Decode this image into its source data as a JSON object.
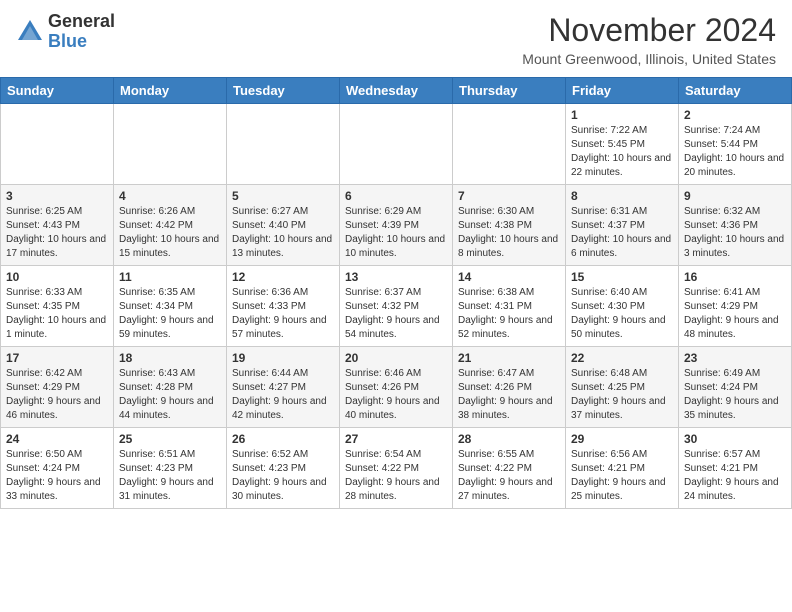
{
  "header": {
    "logo_line1": "General",
    "logo_line2": "Blue",
    "month": "November 2024",
    "location": "Mount Greenwood, Illinois, United States"
  },
  "days_of_week": [
    "Sunday",
    "Monday",
    "Tuesday",
    "Wednesday",
    "Thursday",
    "Friday",
    "Saturday"
  ],
  "weeks": [
    [
      {
        "day": "",
        "info": ""
      },
      {
        "day": "",
        "info": ""
      },
      {
        "day": "",
        "info": ""
      },
      {
        "day": "",
        "info": ""
      },
      {
        "day": "",
        "info": ""
      },
      {
        "day": "1",
        "info": "Sunrise: 7:22 AM\nSunset: 5:45 PM\nDaylight: 10 hours and 22 minutes."
      },
      {
        "day": "2",
        "info": "Sunrise: 7:24 AM\nSunset: 5:44 PM\nDaylight: 10 hours and 20 minutes."
      }
    ],
    [
      {
        "day": "3",
        "info": "Sunrise: 6:25 AM\nSunset: 4:43 PM\nDaylight: 10 hours and 17 minutes."
      },
      {
        "day": "4",
        "info": "Sunrise: 6:26 AM\nSunset: 4:42 PM\nDaylight: 10 hours and 15 minutes."
      },
      {
        "day": "5",
        "info": "Sunrise: 6:27 AM\nSunset: 4:40 PM\nDaylight: 10 hours and 13 minutes."
      },
      {
        "day": "6",
        "info": "Sunrise: 6:29 AM\nSunset: 4:39 PM\nDaylight: 10 hours and 10 minutes."
      },
      {
        "day": "7",
        "info": "Sunrise: 6:30 AM\nSunset: 4:38 PM\nDaylight: 10 hours and 8 minutes."
      },
      {
        "day": "8",
        "info": "Sunrise: 6:31 AM\nSunset: 4:37 PM\nDaylight: 10 hours and 6 minutes."
      },
      {
        "day": "9",
        "info": "Sunrise: 6:32 AM\nSunset: 4:36 PM\nDaylight: 10 hours and 3 minutes."
      }
    ],
    [
      {
        "day": "10",
        "info": "Sunrise: 6:33 AM\nSunset: 4:35 PM\nDaylight: 10 hours and 1 minute."
      },
      {
        "day": "11",
        "info": "Sunrise: 6:35 AM\nSunset: 4:34 PM\nDaylight: 9 hours and 59 minutes."
      },
      {
        "day": "12",
        "info": "Sunrise: 6:36 AM\nSunset: 4:33 PM\nDaylight: 9 hours and 57 minutes."
      },
      {
        "day": "13",
        "info": "Sunrise: 6:37 AM\nSunset: 4:32 PM\nDaylight: 9 hours and 54 minutes."
      },
      {
        "day": "14",
        "info": "Sunrise: 6:38 AM\nSunset: 4:31 PM\nDaylight: 9 hours and 52 minutes."
      },
      {
        "day": "15",
        "info": "Sunrise: 6:40 AM\nSunset: 4:30 PM\nDaylight: 9 hours and 50 minutes."
      },
      {
        "day": "16",
        "info": "Sunrise: 6:41 AM\nSunset: 4:29 PM\nDaylight: 9 hours and 48 minutes."
      }
    ],
    [
      {
        "day": "17",
        "info": "Sunrise: 6:42 AM\nSunset: 4:29 PM\nDaylight: 9 hours and 46 minutes."
      },
      {
        "day": "18",
        "info": "Sunrise: 6:43 AM\nSunset: 4:28 PM\nDaylight: 9 hours and 44 minutes."
      },
      {
        "day": "19",
        "info": "Sunrise: 6:44 AM\nSunset: 4:27 PM\nDaylight: 9 hours and 42 minutes."
      },
      {
        "day": "20",
        "info": "Sunrise: 6:46 AM\nSunset: 4:26 PM\nDaylight: 9 hours and 40 minutes."
      },
      {
        "day": "21",
        "info": "Sunrise: 6:47 AM\nSunset: 4:26 PM\nDaylight: 9 hours and 38 minutes."
      },
      {
        "day": "22",
        "info": "Sunrise: 6:48 AM\nSunset: 4:25 PM\nDaylight: 9 hours and 37 minutes."
      },
      {
        "day": "23",
        "info": "Sunrise: 6:49 AM\nSunset: 4:24 PM\nDaylight: 9 hours and 35 minutes."
      }
    ],
    [
      {
        "day": "24",
        "info": "Sunrise: 6:50 AM\nSunset: 4:24 PM\nDaylight: 9 hours and 33 minutes."
      },
      {
        "day": "25",
        "info": "Sunrise: 6:51 AM\nSunset: 4:23 PM\nDaylight: 9 hours and 31 minutes."
      },
      {
        "day": "26",
        "info": "Sunrise: 6:52 AM\nSunset: 4:23 PM\nDaylight: 9 hours and 30 minutes."
      },
      {
        "day": "27",
        "info": "Sunrise: 6:54 AM\nSunset: 4:22 PM\nDaylight: 9 hours and 28 minutes."
      },
      {
        "day": "28",
        "info": "Sunrise: 6:55 AM\nSunset: 4:22 PM\nDaylight: 9 hours and 27 minutes."
      },
      {
        "day": "29",
        "info": "Sunrise: 6:56 AM\nSunset: 4:21 PM\nDaylight: 9 hours and 25 minutes."
      },
      {
        "day": "30",
        "info": "Sunrise: 6:57 AM\nSunset: 4:21 PM\nDaylight: 9 hours and 24 minutes."
      }
    ]
  ]
}
